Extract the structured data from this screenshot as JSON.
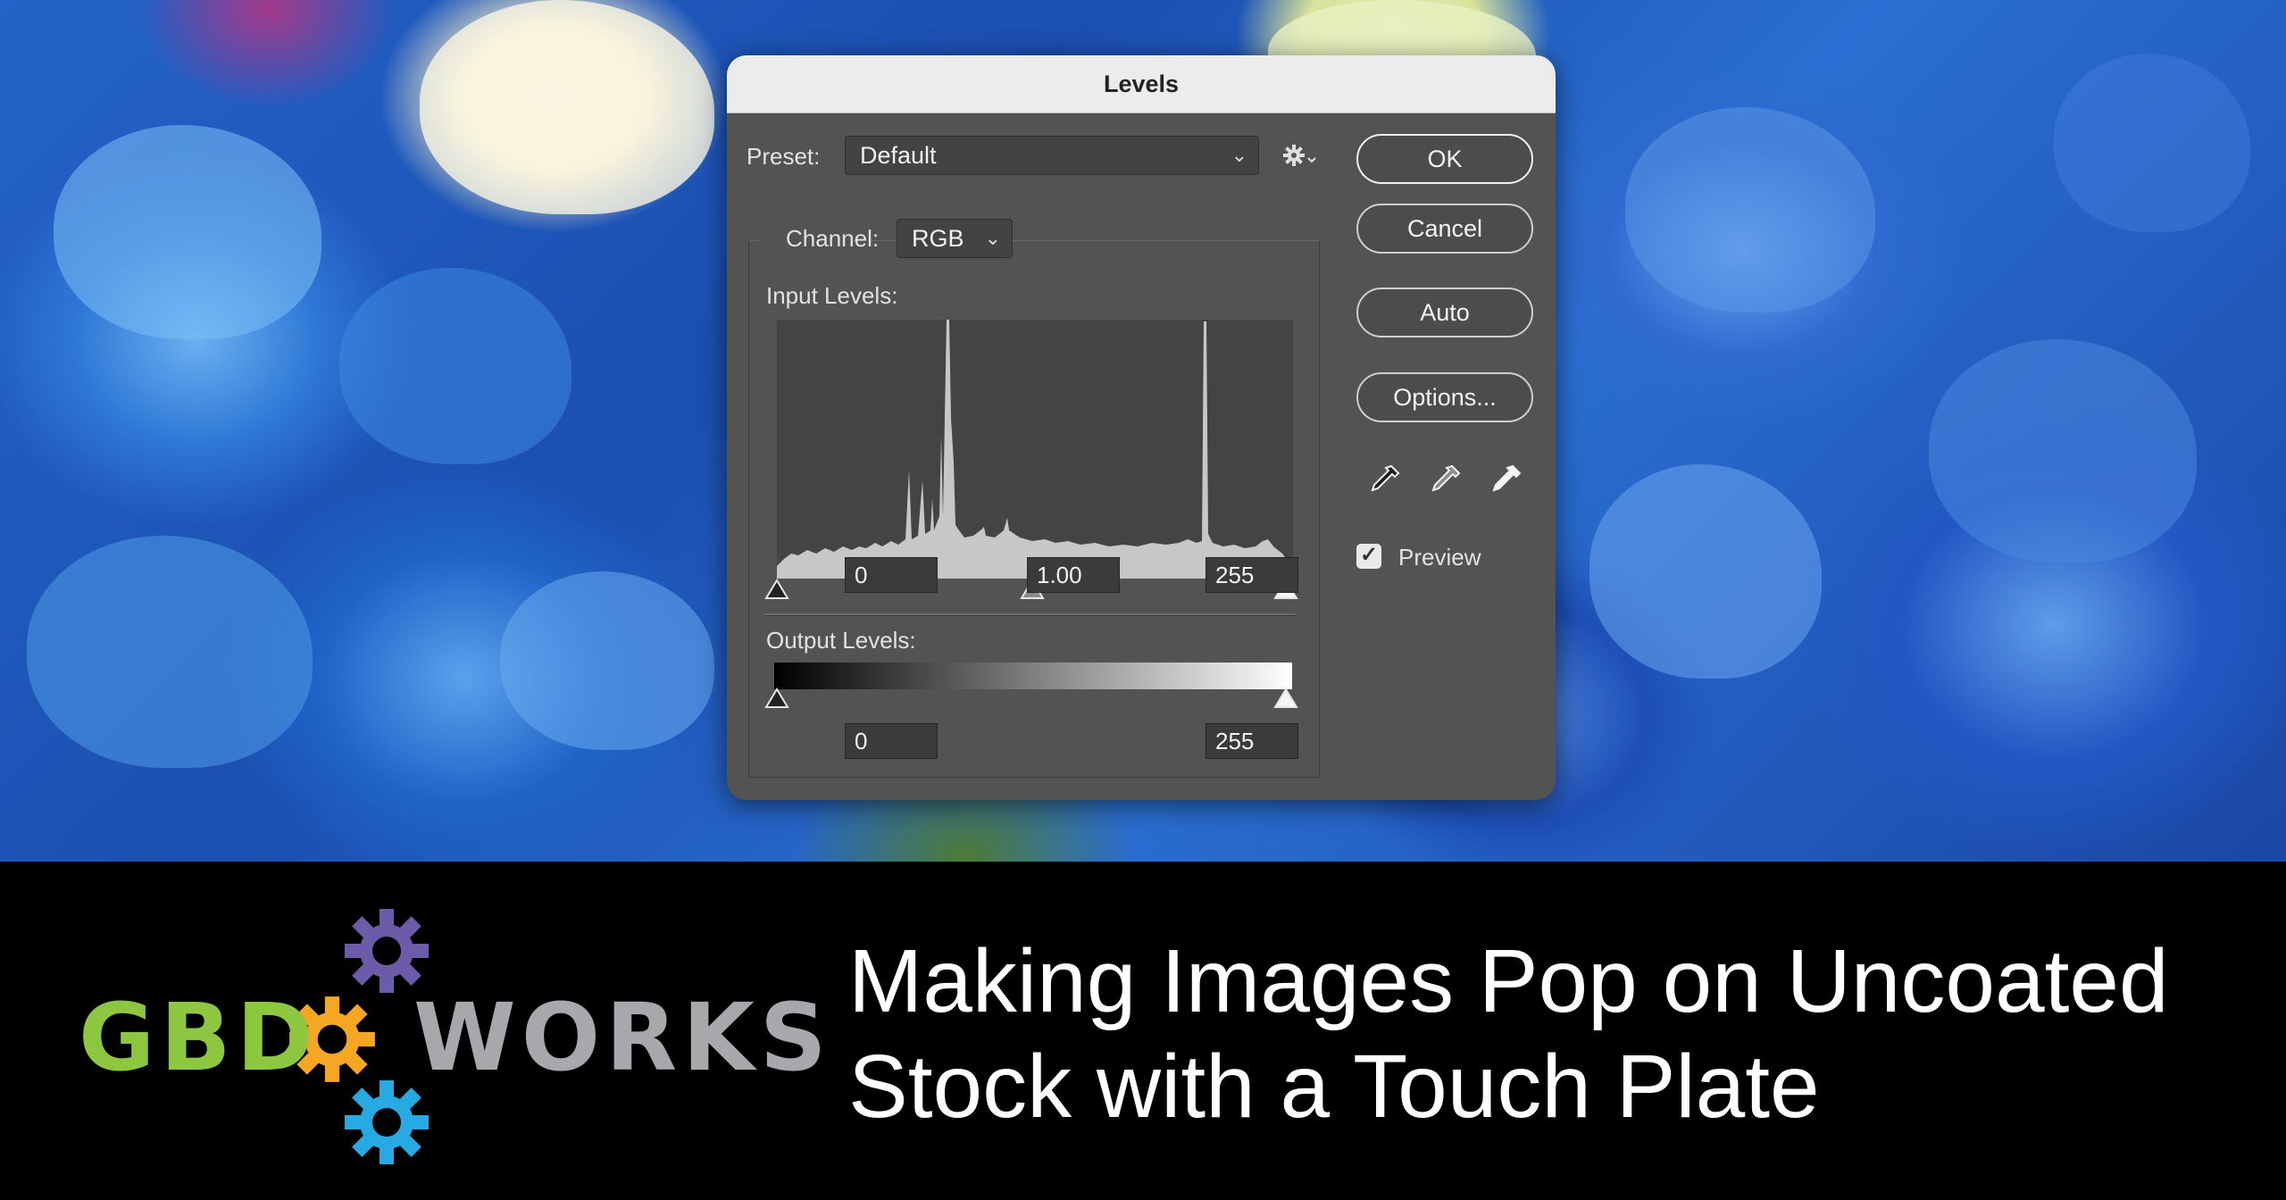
{
  "dialog": {
    "title": "Levels",
    "preset_label": "Preset:",
    "preset_value": "Default",
    "channel_label": "Channel:",
    "channel_value": "RGB",
    "input_levels_label": "Input Levels:",
    "input_black": "0",
    "input_gamma": "1.00",
    "input_white": "255",
    "output_levels_label": "Output Levels:",
    "output_black": "0",
    "output_white": "255",
    "buttons": {
      "ok": "OK",
      "cancel": "Cancel",
      "auto": "Auto",
      "options": "Options..."
    },
    "preview_label": "Preview",
    "preview_checked": true,
    "icons": {
      "gear": "gear-icon",
      "chevron": "chevron-down-icon",
      "eyedroppers": [
        "black-point-eyedropper-icon",
        "gray-point-eyedropper-icon",
        "white-point-eyedropper-icon"
      ]
    }
  },
  "banner": {
    "logo_left": "GBD",
    "logo_right": "WORKS",
    "logo_colors": {
      "gbd": "#8dc63f",
      "works": "#a6a8ab",
      "gear_top": "#6b5ba8",
      "gear_middle": "#f5a623",
      "gear_bottom": "#27aae1"
    },
    "headline_line1": "Making Images Pop on Uncoated",
    "headline_line2": "Stock with a Touch Plate"
  }
}
